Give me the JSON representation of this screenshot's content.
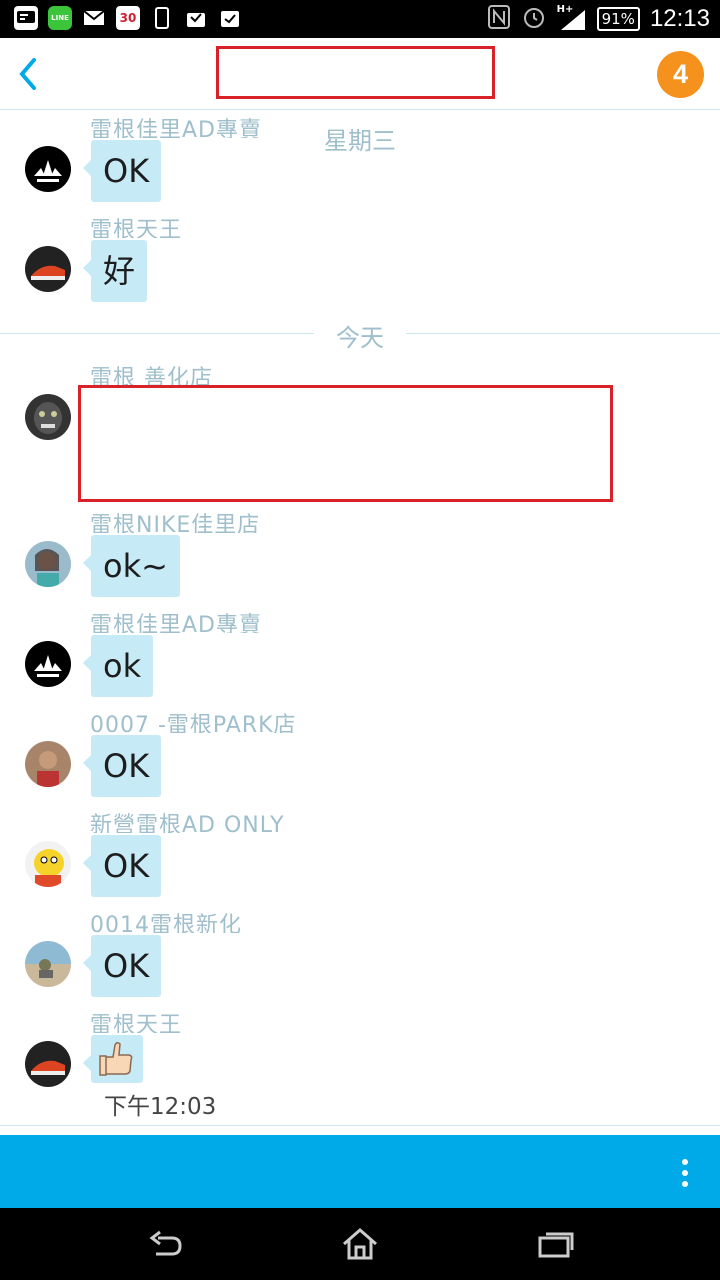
{
  "status_bar": {
    "calendar_day": "30",
    "line_label": "LINE",
    "network": "H+",
    "battery": "91%",
    "time": "12:13"
  },
  "header": {
    "unread_count": "4",
    "accent": "#00a9e8",
    "badge_color": "#f5921e"
  },
  "dividers": {
    "wednesday": "星期三",
    "today": "今天"
  },
  "messages": [
    {
      "sender": "雷根佳里AD專賣",
      "text": "OK",
      "avatar": "adidas-logo"
    },
    {
      "sender": "雷根天王",
      "text": "好",
      "avatar": "red-sneaker"
    },
    {
      "sender": "雷根 善化店",
      "text": "",
      "avatar": "monkey"
    },
    {
      "sender": "雷根NIKE佳里店",
      "text": "ok~",
      "avatar": "woman-photo"
    },
    {
      "sender": "雷根佳里AD專賣",
      "text": "ok",
      "avatar": "adidas-logo"
    },
    {
      "sender": "0007 -雷根PARK店",
      "text": "OK",
      "avatar": "person-photo"
    },
    {
      "sender": "新營雷根AD ONLY",
      "text": "OK",
      "avatar": "cartoon-character"
    },
    {
      "sender": "0014雷根新化",
      "text": "OK",
      "avatar": "beach-photo"
    },
    {
      "sender": "雷根天王",
      "text": "",
      "avatar": "red-sneaker"
    }
  ],
  "last_message_time": "下午12:03"
}
